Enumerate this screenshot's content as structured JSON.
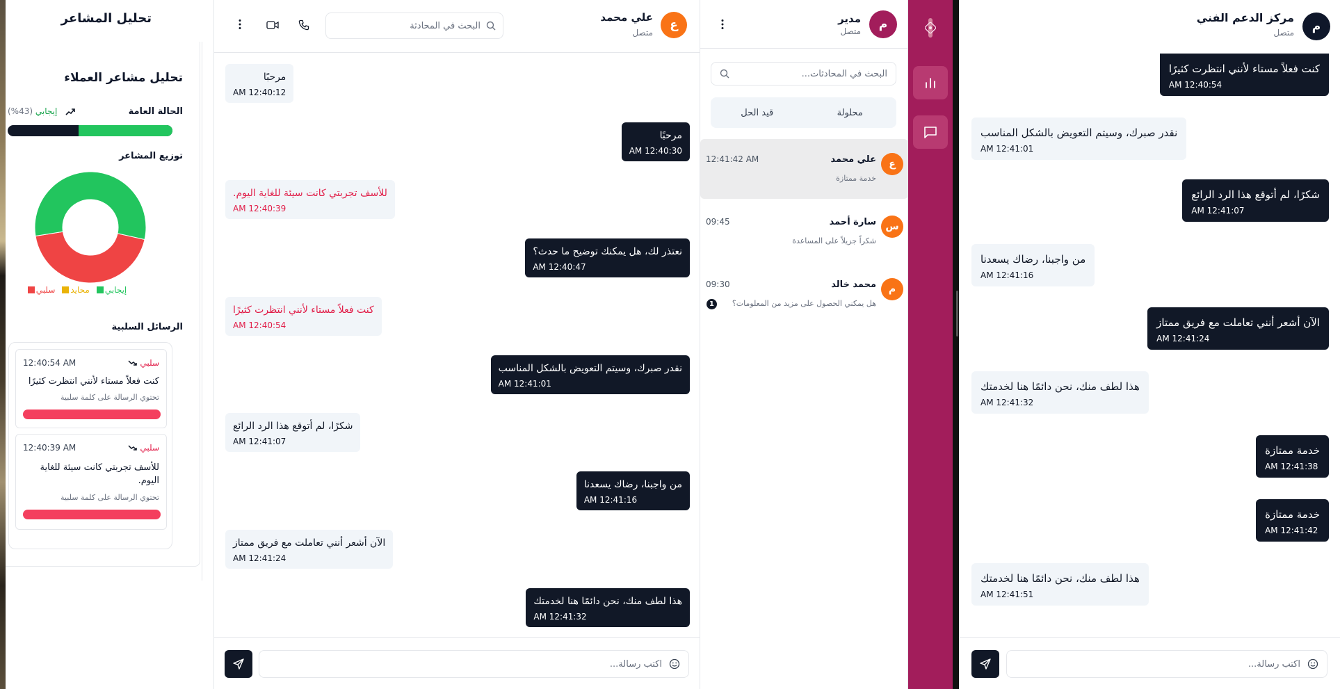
{
  "analysis": {
    "header_title": "تحليل المشاعر",
    "card_title": "تحليل مشاعر العملاء",
    "overall_label": "الحالة العامة",
    "overall_value": "إيجابي",
    "overall_percent": "(43%)",
    "overall_positive_fraction": 0.57,
    "distribution_label": "توزيع المشاعر",
    "distribution": [
      {
        "name": "إيجابي",
        "value": 0.56,
        "color": "#22c55e"
      },
      {
        "name": "محايد",
        "value": 0.0,
        "color": "#eab308"
      },
      {
        "name": "سلبي",
        "value": 0.44,
        "color": "#ef4444"
      }
    ],
    "legend": {
      "positive": "إيجابي",
      "neutral": "محايد",
      "negative": "سلبي"
    },
    "negative_title": "الرسائل السلبية",
    "negative_messages": [
      {
        "label": "سلبي",
        "time": "12:40:54 AM",
        "text": "كنت فعلاً مستاء لأنني انتظرت كثيرًا",
        "reason": "تحتوي الرسالة على كلمة سلبية",
        "bar": 1.0
      },
      {
        "label": "سلبي",
        "time": "12:40:39 AM",
        "text": "للأسف تجربتي كانت سيئة للغاية اليوم.",
        "reason": "تحتوي الرسالة على كلمة سلبية",
        "bar": 1.0
      }
    ],
    "colors": {
      "positive": "#22c55e",
      "negative": "#ef4444",
      "neutral": "#eab308",
      "dark": "#111827"
    }
  },
  "center_chat": {
    "contact_name": "علي محمد",
    "contact_status": "متصل",
    "avatar_letter": "ع",
    "search_placeholder": "البحث في المحادثة",
    "input_placeholder": "اكتب رسالة...",
    "messages": [
      {
        "side": "user",
        "text": "مرحبًا",
        "time": "12:40:12 AM"
      },
      {
        "side": "agent",
        "text": "مرحبًا",
        "time": "12:40:30 AM"
      },
      {
        "side": "user",
        "text": "للأسف تجربتي كانت سيئة للغاية اليوم.",
        "time": "12:40:39 AM",
        "negative": true
      },
      {
        "side": "agent",
        "text": "نعتذر لك، هل يمكنك توضيح ما حدث؟",
        "time": "12:40:47 AM"
      },
      {
        "side": "user",
        "text": "كنت فعلاً مستاء لأنني انتظرت كثيرًا",
        "time": "12:40:54 AM",
        "negative": true
      },
      {
        "side": "agent",
        "text": "نقدر صبرك، وسيتم التعويض بالشكل المناسب",
        "time": "12:41:01 AM"
      },
      {
        "side": "user",
        "text": "شكرًا، لم أتوقع هذا الرد الرائع",
        "time": "12:41:07 AM"
      },
      {
        "side": "agent",
        "text": "من واجبنا، رضاك يسعدنا",
        "time": "12:41:16 AM"
      },
      {
        "side": "user",
        "text": "الآن أشعر أنني تعاملت مع فريق ممتاز",
        "time": "12:41:24 AM"
      },
      {
        "side": "agent",
        "text": "هذا لطف منك، نحن دائمًا هنا لخدمتك",
        "time": "12:41:32 AM"
      }
    ]
  },
  "conversation_list": {
    "user_name": "مدير",
    "user_status": "متصل",
    "avatar_letter": "م",
    "search_placeholder": "البحث في المحادثات...",
    "tabs": [
      "محلولة",
      "قيد الحل"
    ],
    "items": [
      {
        "name": "علي محمد",
        "time": "12:41:42 AM",
        "preview": "خدمة ممتازة",
        "avatar": "ع",
        "unread": ""
      },
      {
        "name": "سارة أحمد",
        "time": "09:45",
        "preview": "شكراً جزيلاً على المساعدة",
        "avatar": "س",
        "unread": ""
      },
      {
        "name": "محمد خالد",
        "time": "09:30",
        "preview": "هل يمكني الحصول على مزيد من المعلومات؟",
        "avatar": "م",
        "unread": "1"
      }
    ]
  },
  "right_chat": {
    "title": "مركز الدعم الفني",
    "status": "متصل",
    "avatar_letter": "م",
    "input_placeholder": "اكتب رسالة...",
    "messages": [
      {
        "side": "own",
        "text": "كنت فعلاً مستاء لأنني انتظرت كثيرًا",
        "time": "12:40:54 AM"
      },
      {
        "side": "other",
        "text": "نقدر صبرك، وسيتم التعويض بالشكل المناسب",
        "time": "12:41:01 AM"
      },
      {
        "side": "own",
        "text": "شكرًا، لم أتوقع هذا الرد الرائع",
        "time": "12:41:07 AM"
      },
      {
        "side": "other",
        "text": "من واجبنا، رضاك يسعدنا",
        "time": "12:41:16 AM"
      },
      {
        "side": "own",
        "text": "الآن أشعر أنني تعاملت مع فريق ممتاز",
        "time": "12:41:24 AM"
      },
      {
        "side": "other",
        "text": "هذا لطف منك، نحن دائمًا هنا لخدمتك",
        "time": "12:41:32 AM"
      },
      {
        "side": "own",
        "text": "خدمة ممتازة",
        "time": "12:41:38 AM"
      },
      {
        "side": "own",
        "text": "خدمة ممتازة",
        "time": "12:41:42 AM"
      },
      {
        "side": "other",
        "text": "هذا لطف منك، نحن دائمًا هنا لخدمتك",
        "time": "12:41:51 AM"
      }
    ]
  },
  "colors": {
    "accent": "#a21d5b",
    "dark": "#111827",
    "avatar_orange": "#f97316",
    "avatar_dark": "#0f172a"
  }
}
